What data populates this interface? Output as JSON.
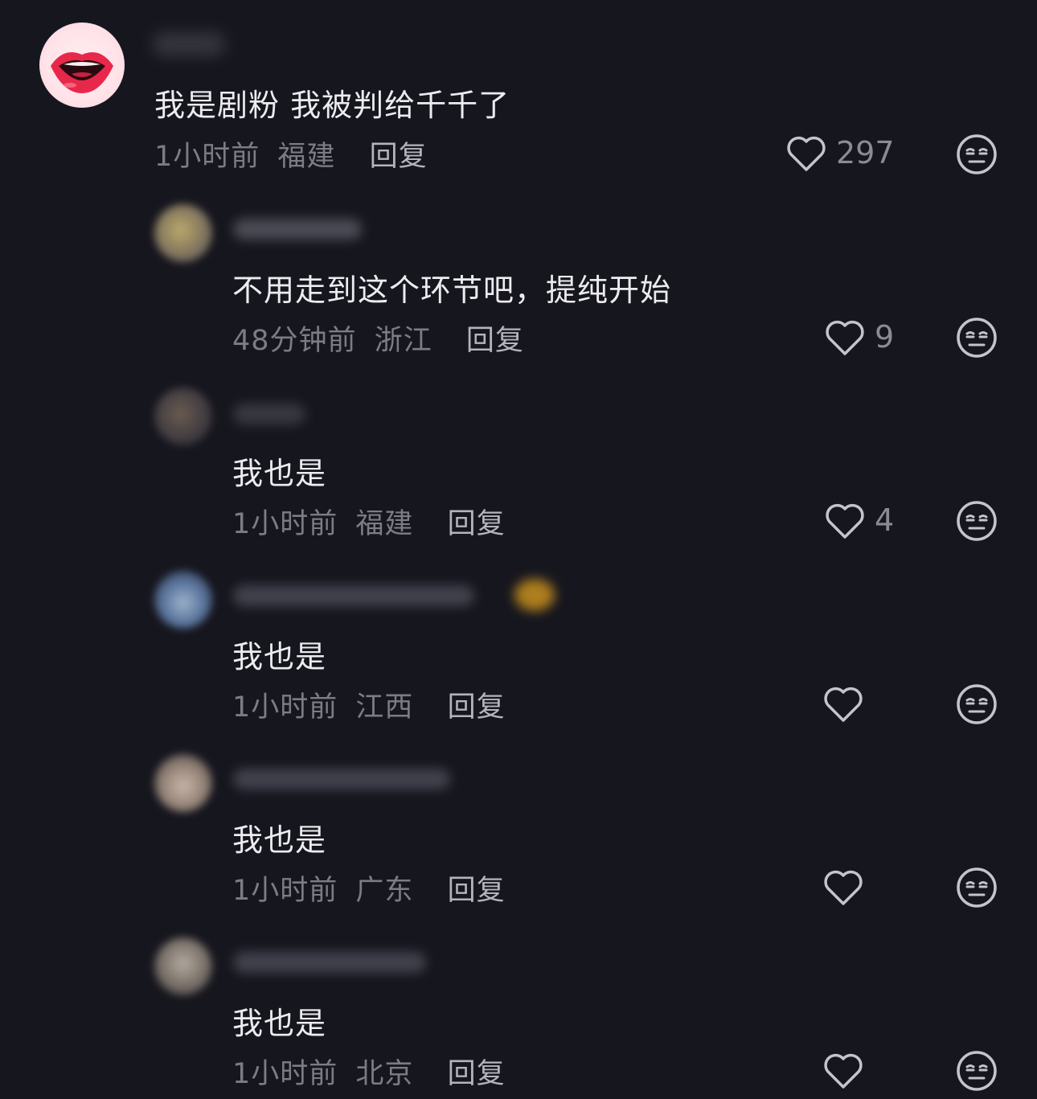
{
  "comments": [
    {
      "text": "我是剧粉 我被判给千千了",
      "time": "1小时前",
      "location": "福建",
      "reply_label": "回复",
      "likes": "297"
    },
    {
      "text": "不用走到这个环节吧，提纯开始",
      "time": "48分钟前",
      "location": "浙江",
      "reply_label": "回复",
      "likes": "9"
    },
    {
      "text": "我也是",
      "time": "1小时前",
      "location": "福建",
      "reply_label": "回复",
      "likes": "4"
    },
    {
      "text": "我也是",
      "time": "1小时前",
      "location": "江西",
      "reply_label": "回复",
      "likes": ""
    },
    {
      "text": "我也是",
      "time": "1小时前",
      "location": "广东",
      "reply_label": "回复",
      "likes": ""
    },
    {
      "text": "我也是",
      "time": "1小时前",
      "location": "北京",
      "reply_label": "回复",
      "likes": ""
    }
  ],
  "icons": {
    "like": "heart-outline-icon",
    "dislike": "unamused-face-icon"
  },
  "colors": {
    "background": "#16161e",
    "text": "#ececf0",
    "meta": "#7c7c86",
    "reply": "#b4b4bc",
    "icon": "#c4c4cc"
  }
}
